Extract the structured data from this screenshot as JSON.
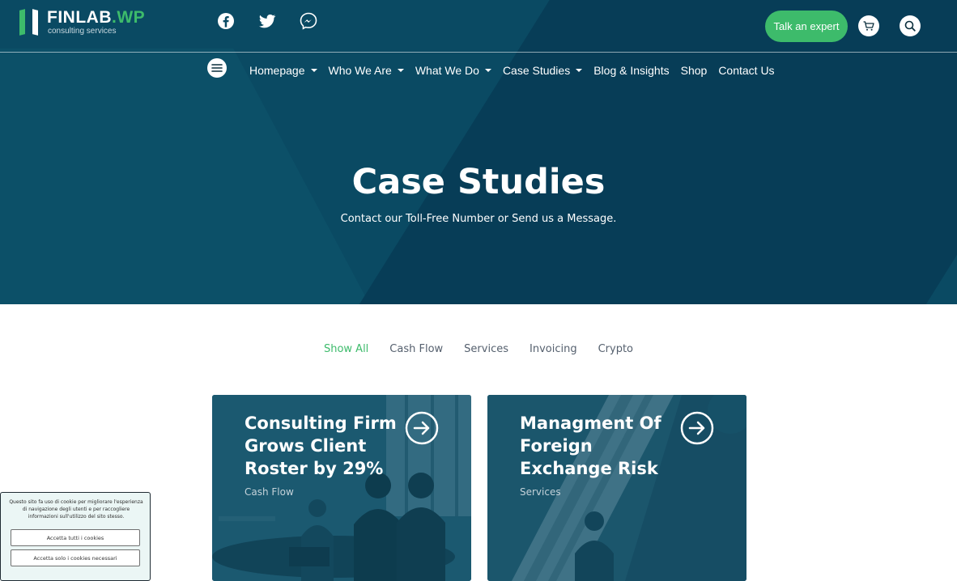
{
  "header": {
    "logo_main": "FINLAB",
    "logo_accent": ".WP",
    "logo_tagline": "consulting services",
    "social": [
      {
        "icon": "facebook-icon"
      },
      {
        "icon": "twitter-icon"
      },
      {
        "icon": "messenger-icon"
      }
    ],
    "cta_label": "Talk an expert",
    "cart_icon": "cart-icon",
    "search_icon": "search-icon"
  },
  "nav": {
    "menu_icon": "hamburger-menu-icon",
    "items": [
      {
        "label": "Homepage",
        "has_dropdown": true
      },
      {
        "label": "Who We Are",
        "has_dropdown": true
      },
      {
        "label": "What We Do",
        "has_dropdown": true
      },
      {
        "label": "Case Studies",
        "has_dropdown": true
      },
      {
        "label": "Blog & Insights",
        "has_dropdown": false
      },
      {
        "label": "Shop",
        "has_dropdown": false
      },
      {
        "label": "Contact Us",
        "has_dropdown": false
      }
    ]
  },
  "hero": {
    "title": "Case Studies",
    "subtitle": "Contact our Toll-Free Number or Send us a Message."
  },
  "filters": {
    "items": [
      "Show All",
      "Cash Flow",
      "Services",
      "Invoicing",
      "Crypto"
    ],
    "active": "Show All"
  },
  "cards": [
    {
      "title": "Consulting Firm Grows Client Roster by 29%",
      "category": "Cash Flow"
    },
    {
      "title": "Managment Of Foreign Exchange Risk",
      "category": "Services"
    }
  ],
  "cookie_banner": {
    "text": "Questo sito fa uso di cookie per migliorare l'esperienza di navigazione degli utenti e per raccogliere informazioni sull'utilizzo del sito stesso.",
    "accept_all": "Accetta tutti i cookies",
    "accept_necessary": "Accetta solo i cookies necessari"
  },
  "colors": {
    "hero_bg": "#0a4a63",
    "accent_green": "#3dbb6b",
    "card_overlay": "#0e4a63"
  }
}
